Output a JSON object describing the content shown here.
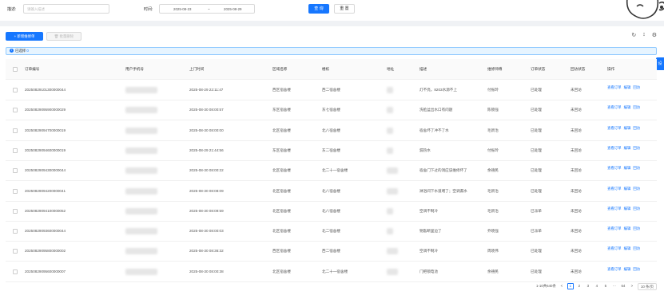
{
  "search": {
    "desc_label": "描述:",
    "desc_placeholder": "请输入描述",
    "time_label": "时间:",
    "date_start": "2025-08-23",
    "date_sep": "~",
    "date_end": "2025-08-29",
    "query_btn": "查 询",
    "reset_btn": "重 置"
  },
  "toolbar": {
    "add_btn": "+ 新增维修单",
    "batch_delete_btn": "批量删除",
    "reload_icon": "reload-icon",
    "column_height_icon": "column-height-icon",
    "setting_icon": "setting-icon"
  },
  "side_tab": "设",
  "selection": {
    "text": "已选择",
    "count": "0"
  },
  "columns": [
    "订单编号",
    "用户手机号",
    "上门时间",
    "区域名称",
    "楼栋",
    "地址",
    "描述",
    "维修师傅",
    "订单状态",
    "回访状态",
    "操作"
  ],
  "rows": [
    {
      "order_no": "20250829101300000044",
      "visit_time": "2025-08-29 22:11:47",
      "area": "西区宿舍楼",
      "building": "西二宿舍楼",
      "desc": "灯不亮，8203水源不上",
      "worker": "付振玲",
      "status": "已处理",
      "followup": "未回访"
    },
    {
      "order_no": "20250829095900000029",
      "visit_time": "2025-08-30 08:00:57",
      "area": "东区宿舍楼",
      "building": "东七宿舍楼",
      "desc": "洗脸盆出水口有问题",
      "worker": "陈锁强",
      "status": "已处理",
      "followup": "未回访"
    },
    {
      "order_no": "20250829094700000019",
      "visit_time": "2025-08-30 08:00:00",
      "area": "北区宿舍楼",
      "building": "北八宿舍楼",
      "desc": "宿舍坏了冲不了水",
      "worker": "毛新治",
      "status": "已处理",
      "followup": "未回访"
    },
    {
      "order_no": "20250829094600000019",
      "visit_time": "2025-08-29 21:44:56",
      "area": "东区宿舍楼",
      "building": "东二宿舍楼",
      "desc": "漏热水",
      "worker": "付振玲",
      "status": "已处理",
      "followup": "未回访"
    },
    {
      "order_no": "20250829094300000044",
      "visit_time": "2025-08-30 08:00:22",
      "area": "北区宿舍楼",
      "building": "北二十一宿舍楼",
      "desc": "宿舍门下过的洞应该维修坏了",
      "worker": "余禧民",
      "status": "已处理",
      "followup": "未回访"
    },
    {
      "order_no": "20250829094200000041",
      "visit_time": "2025-08-30 08:08:09",
      "area": "北区宿舍楼",
      "building": "北八宿舍楼",
      "desc": "淋浴间下水道堵了；空调漏水",
      "worker": "毛新治",
      "status": "已处理",
      "followup": "未回访"
    },
    {
      "order_no": "20250829094100000052",
      "visit_time": "2025-08-30 08:09:59",
      "area": "北区宿舍楼",
      "building": "北八宿舍楼",
      "desc": "空调不制冷",
      "worker": "毛新治",
      "status": "已派单",
      "followup": "未回访"
    },
    {
      "order_no": "20250829093600000044",
      "visit_time": "2025-08-30 08:00:03",
      "area": "北区宿舍楼",
      "building": "北二宿舍楼",
      "desc": "钥匙断里边了",
      "worker": "乔晓强",
      "status": "已派单",
      "followup": "未回访"
    },
    {
      "order_no": "20250829095800000002",
      "visit_time": "2025-08-30 08:36:32",
      "area": "西区宿舍楼",
      "building": "西二宿舍楼",
      "desc": "空调不制冷",
      "worker": "周晓伟",
      "status": "已处理",
      "followup": "未回访"
    },
    {
      "order_no": "20250829095600000007",
      "visit_time": "2025-08-30 08:00:38",
      "area": "北区宿舍楼",
      "building": "北二十一宿舍楼",
      "desc": "门把锁电池",
      "worker": "余禧民",
      "status": "已处理",
      "followup": "未回访"
    }
  ],
  "actions": {
    "view": "查看订单",
    "edit": "编辑",
    "revisit": "回访"
  },
  "pagination": {
    "total": "1-10共640条",
    "prev": "<",
    "pages": [
      "1",
      "2",
      "3",
      "4",
      "5",
      "···",
      "64"
    ],
    "next": ">",
    "page_size": "10 条/页"
  },
  "colors": {
    "primary": "#1677ff",
    "selected_bg": "#e6f4ff"
  }
}
